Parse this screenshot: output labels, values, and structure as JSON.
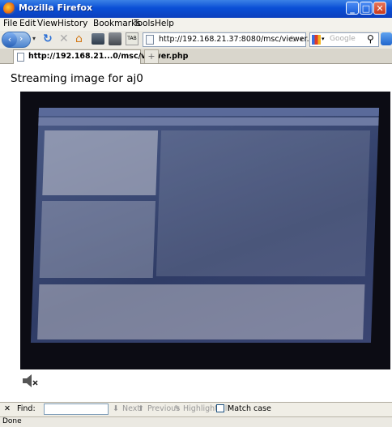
{
  "window": {
    "title": "Mozilla Firefox",
    "minimize": "_",
    "maximize": "□",
    "close": "✕"
  },
  "menu": [
    "File",
    "Edit",
    "View",
    "History",
    "Bookmarks",
    "Tools",
    "Help"
  ],
  "nav": {
    "back": "‹",
    "forward": "›",
    "url": "http://192.168.21.37:8080/msc/viewer.php",
    "search_placeholder": "Google"
  },
  "tabs": [
    {
      "label": "http://192.168.21...0/msc/viewer.php"
    }
  ],
  "new_tab": "+",
  "page": {
    "heading": "Streaming image for aj0"
  },
  "findbar": {
    "close": "✕",
    "label": "Find:",
    "next": "Next",
    "previous": "Previous",
    "highlight": "Highlight all",
    "match_case": "Match case"
  },
  "status": "Done"
}
